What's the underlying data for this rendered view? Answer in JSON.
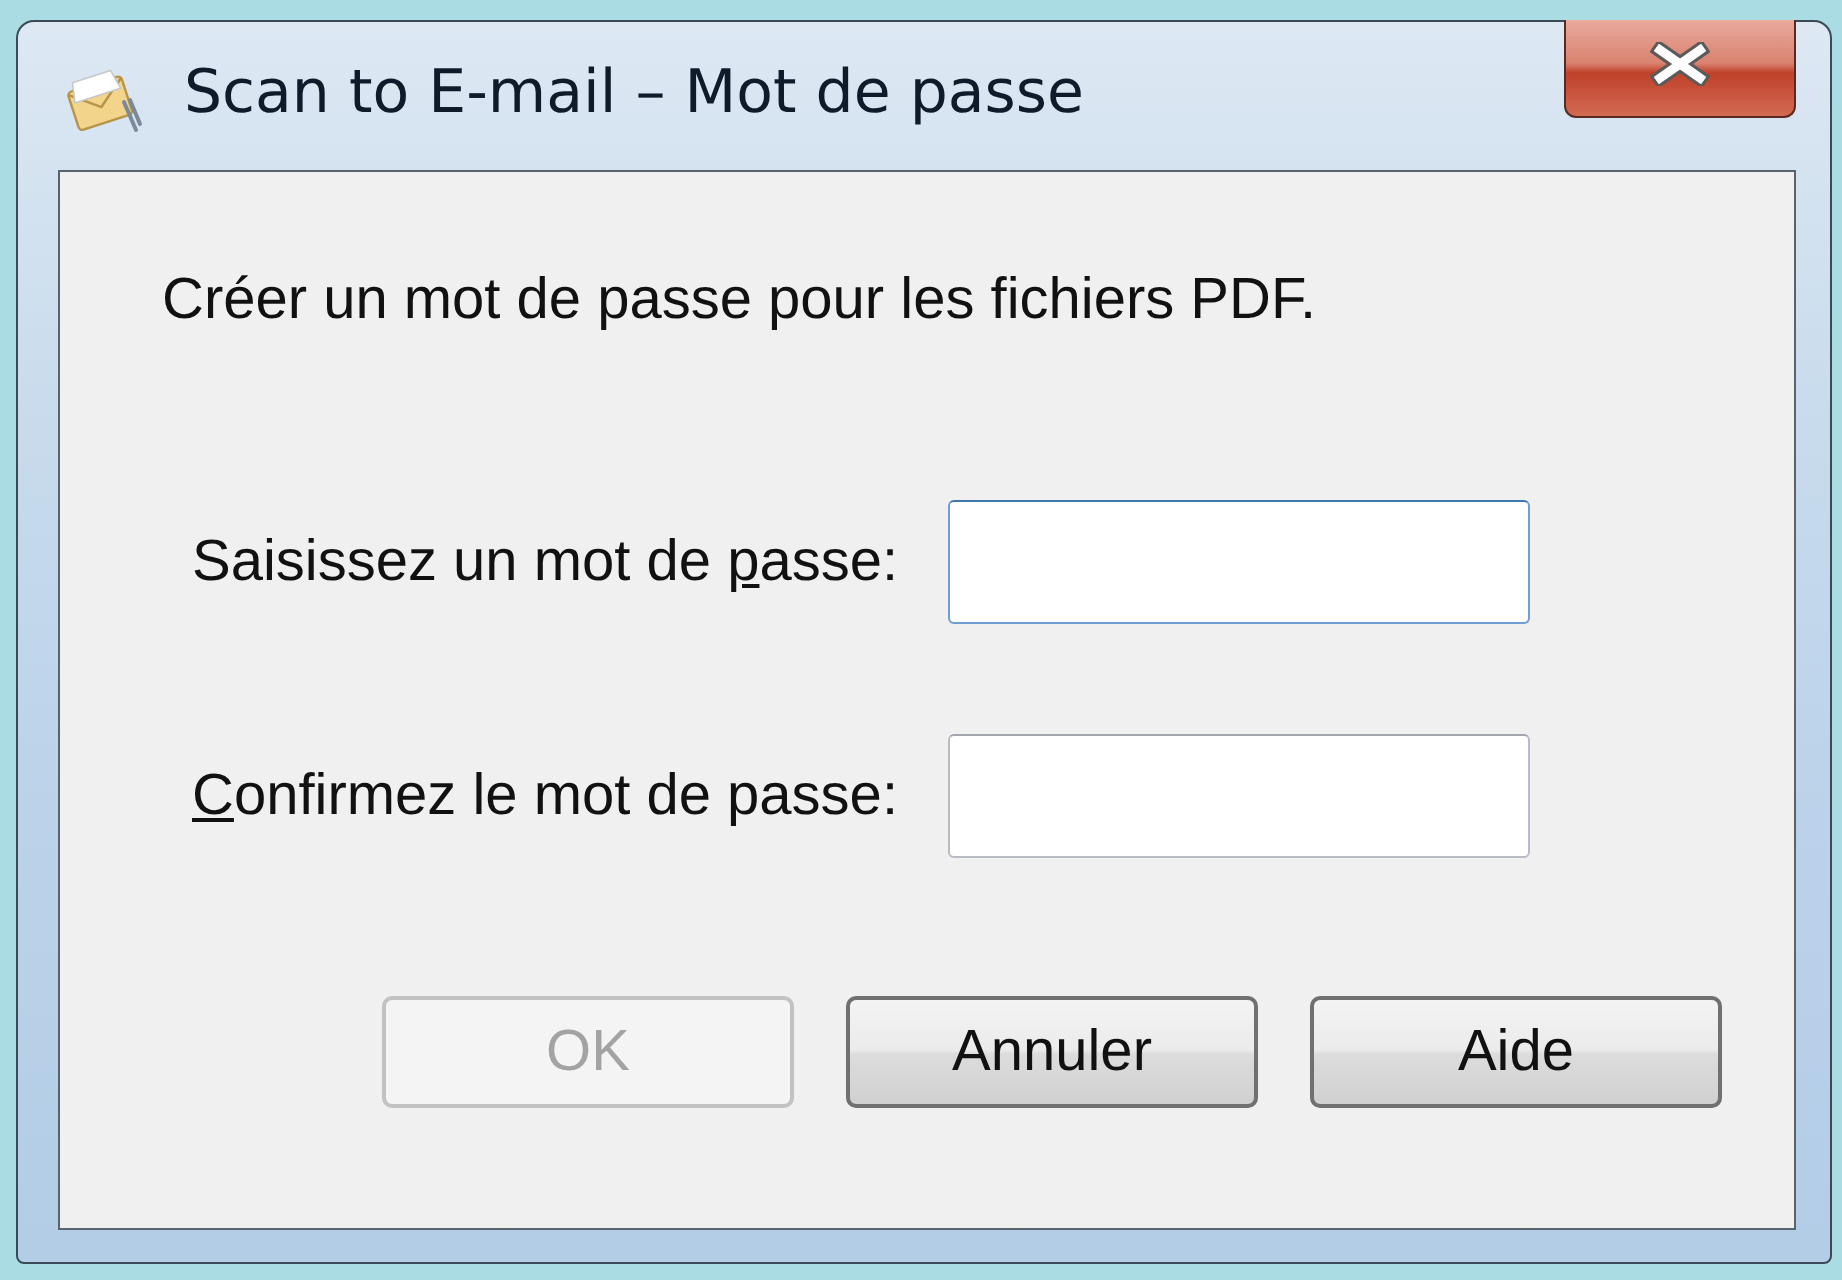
{
  "window": {
    "title": "Scan to E-mail – Mot de passe"
  },
  "message": "Créer un mot de passe pour les fichiers PDF.",
  "fields": [
    {
      "label": {
        "before": "Saisissez un mot de ",
        "access_key": "p",
        "after": "asse:"
      },
      "focused": true
    },
    {
      "label": {
        "access_key": "C",
        "after": "onfirmez le mot de passe:"
      },
      "focused": false
    }
  ],
  "buttons": [
    {
      "label": "OK",
      "disabled": true
    },
    {
      "label": "Annuler",
      "disabled": false
    },
    {
      "label": "Aide",
      "disabled": false
    }
  ]
}
